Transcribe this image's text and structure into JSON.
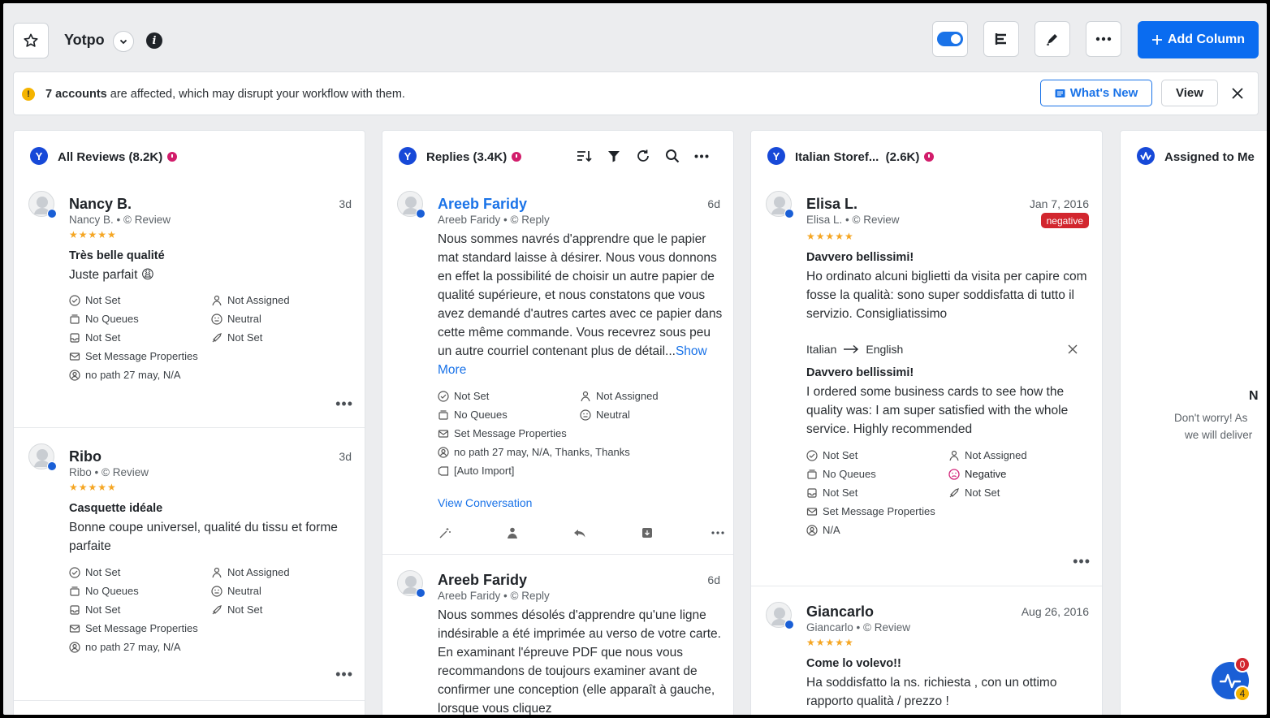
{
  "header": {
    "title": "Yotpo",
    "add_column_label": "Add Column"
  },
  "banner": {
    "count_text": "7 accounts",
    "rest_text": " are affected, which may disrupt your workflow with them.",
    "whats_new_label": "What's New",
    "view_label": "View"
  },
  "columns": [
    {
      "title": "All Reviews (8.2K)",
      "cards": [
        {
          "author": "Nancy B.",
          "time": "3d",
          "sub_name": "Nancy B.",
          "sub_type": "Review",
          "stars": "★★★★★",
          "title": "Très belle qualité",
          "body": "Juste parfait 😩",
          "props": [
            "Not Set",
            "Not Assigned",
            "No Queues",
            "Neutral",
            "Not Set",
            "Not Set",
            "Set Message Properties",
            "no path 27 may, N/A"
          ]
        },
        {
          "author": "Ribo",
          "time": "3d",
          "sub_name": "Ribo",
          "sub_type": "Review",
          "stars": "★★★★★",
          "title": "Casquette idéale",
          "body": "Bonne coupe universel, qualité du tissu et forme parfaite",
          "props": [
            "Not Set",
            "Not Assigned",
            "No Queues",
            "Neutral",
            "Not Set",
            "Not Set",
            "Set Message Properties",
            "no path 27 may, N/A"
          ]
        }
      ]
    },
    {
      "title": "Replies (3.4K)",
      "cards": [
        {
          "author": "Areeb Faridy",
          "time": "6d",
          "sub_name": "Areeb Faridy",
          "sub_type": "Reply",
          "body": "Nous sommes navrés d'apprendre que le papier mat standard laisse à désirer. Nous vous donnons en effet la possibilité de choisir un autre papier de qualité supérieure, et nous constatons que vous avez demandé d'autres cartes avec ce papier dans cette même commande. Vous recevrez sous peu un autre courriel contenant plus de détail...",
          "show_more": "Show More",
          "props": [
            "Not Set",
            "Not Assigned",
            "No Queues",
            "Neutral",
            "Set Message Properties",
            "no path 27 may, N/A, Thanks, Thanks",
            "[Auto Import]"
          ],
          "view_conversation": "View Conversation"
        },
        {
          "author": "Areeb Faridy",
          "time": "6d",
          "sub_name": "Areeb Faridy",
          "sub_type": "Reply",
          "body": "Nous sommes désolés d'apprendre qu'une ligne indésirable a été imprimée au verso de votre carte. En examinant l'épreuve PDF que nous vous recommandons de toujours examiner avant de confirmer une conception (elle apparaît à gauche, lorsque vous cliquez"
        }
      ]
    },
    {
      "title": "Italian Storef...  (2.6K)",
      "cards": [
        {
          "author": "Elisa L.",
          "time": "Jan 7, 2016",
          "badge": "negative",
          "sub_name": "Elisa L.",
          "sub_type": "Review",
          "stars": "★★★★★",
          "title": "Davvero bellissimi!",
          "body": "Ho ordinato alcuni biglietti da visita per capire com fosse la qualità: sono super soddisfatta di tutto il servizio. Consigliatissimo",
          "translation_from": "Italian",
          "translation_to": "English",
          "translated_title": "Davvero bellissimi!",
          "translated_body": "I ordered some business cards to see how the quality was: I am super satisfied with the whole service. Highly recommended",
          "props": [
            "Not Set",
            "Not Assigned",
            "No Queues",
            "Negative",
            "Not Set",
            "Not Set",
            "Set Message Properties",
            "N/A"
          ]
        },
        {
          "author": "Giancarlo",
          "time": "Aug 26, 2016",
          "sub_name": "Giancarlo",
          "sub_type": "Review",
          "stars": "★★★★★",
          "title": "Come lo volevo!!",
          "body": "Ha soddisfatto la ns. richiesta , con un ottimo rapporto qualità / prezzo !"
        }
      ]
    },
    {
      "title": "Assigned to Me",
      "partial_heading": "N",
      "partial_line1": "Don't worry! As",
      "partial_line2": "we will deliver"
    }
  ],
  "fab": {
    "top_count": "0",
    "bottom_count": "4"
  },
  "colors": {
    "accent": "#1a73e8",
    "brand": "#1749d8",
    "negative": "#d2262e",
    "stars": "#f5a623"
  }
}
